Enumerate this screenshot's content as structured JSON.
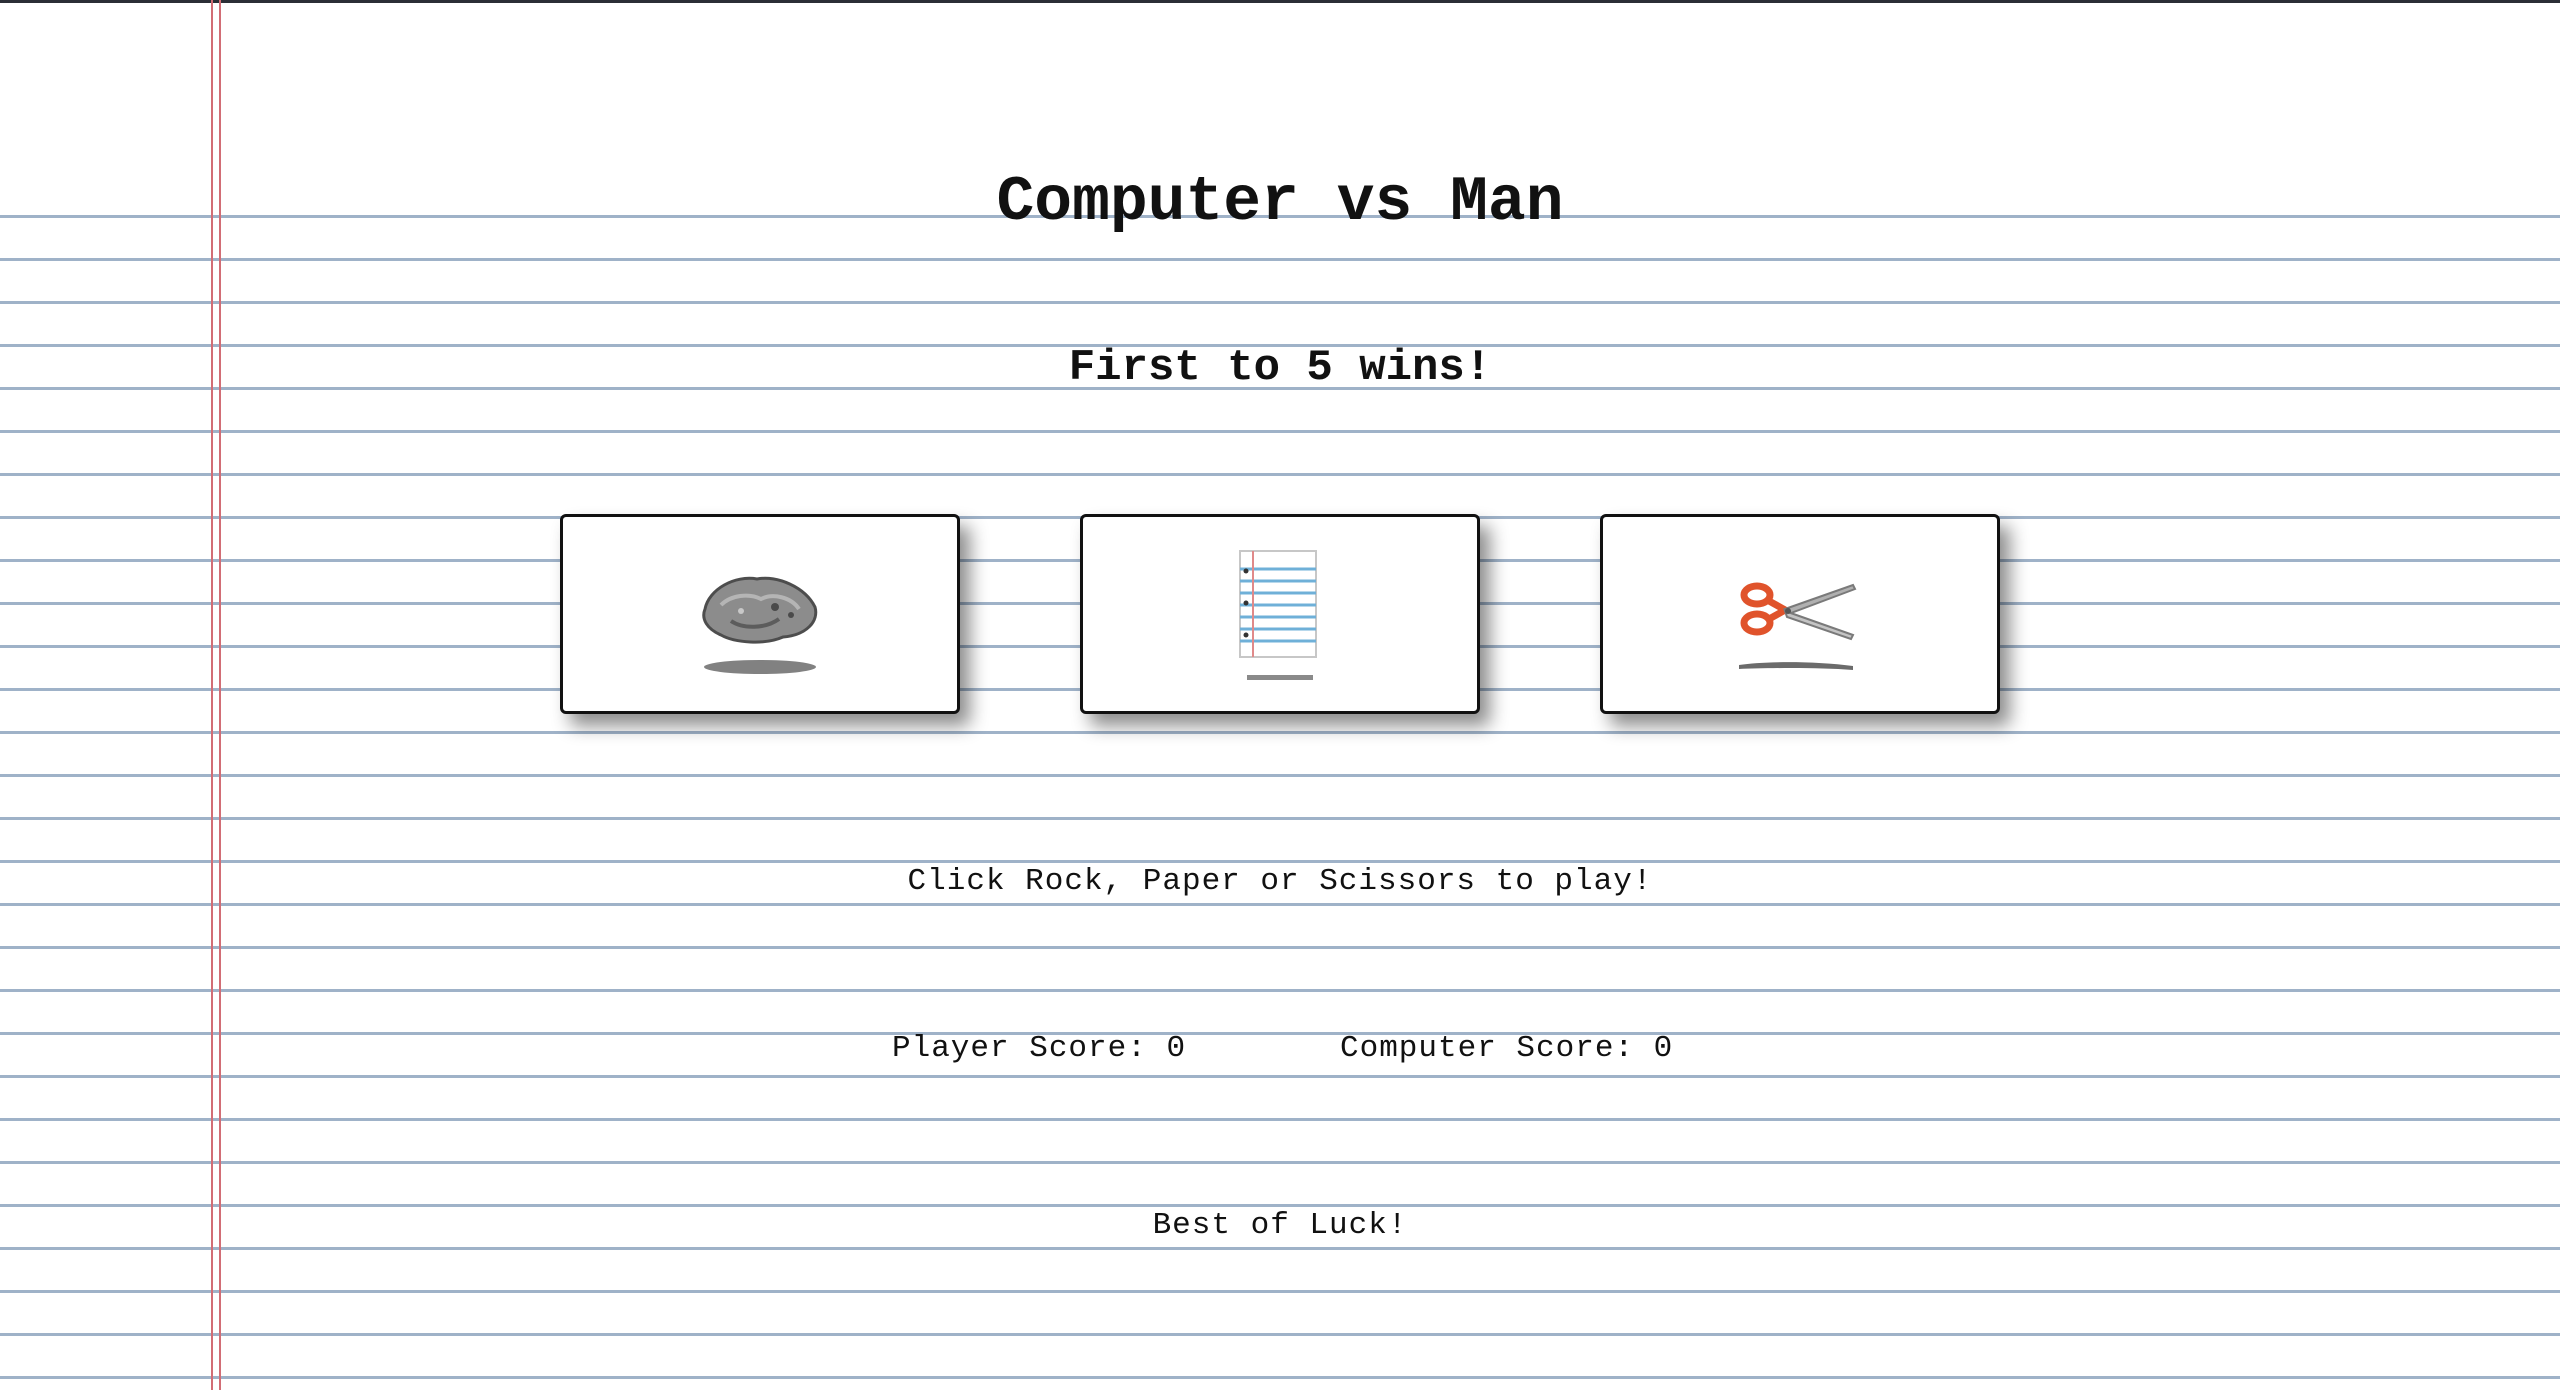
{
  "header": {
    "title": "Computer vs Man",
    "subtitle": "First to 5 wins!"
  },
  "choices": [
    {
      "name": "Rock",
      "icon": "rock-icon"
    },
    {
      "name": "Paper",
      "icon": "paper-icon"
    },
    {
      "name": "Scissors",
      "icon": "scissors-icon"
    }
  ],
  "status": {
    "message": "Click Rock, Paper or Scissors to play!",
    "player_score_label": "Player Score: 0",
    "computer_score_label": "Computer Score: 0",
    "luck": "Best of Luck!"
  },
  "colors": {
    "rule_line": "#9fb2c8",
    "margin_line": "#d26d75",
    "scissors_handle": "#e0532b"
  }
}
